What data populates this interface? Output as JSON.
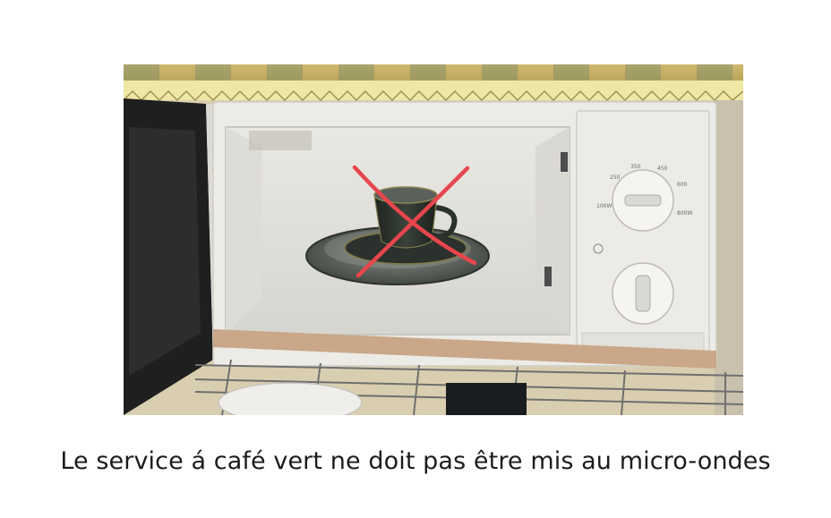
{
  "photo": {
    "subject": "microwave-with-coffee-cup-crossed-out",
    "colors": {
      "cross": "#e8454c",
      "cup": "#2b312c",
      "microwave": "#ecebe6",
      "cavity": "#e4e3de",
      "shelf": "#c9a788",
      "curtain": "#d8c26a"
    }
  },
  "dial_top": {
    "marks": [
      "800W",
      "600",
      "450",
      "350",
      "250",
      "100W"
    ]
  },
  "caption": {
    "text": "Le service á café vert ne doit pas être mis au micro-ondes"
  }
}
